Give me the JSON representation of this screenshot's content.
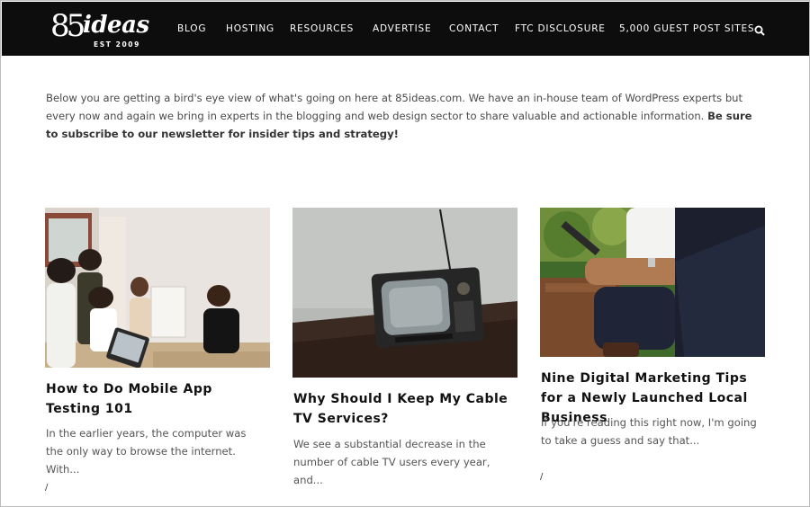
{
  "header": {
    "logo": {
      "number": "85",
      "word": "ideas",
      "tagline": "EST 2009"
    },
    "nav": [
      {
        "label": "BLOG"
      },
      {
        "label": "HOSTING"
      },
      {
        "label": "RESOURCES"
      },
      {
        "label": "ADVERTISE"
      },
      {
        "label": "CONTACT"
      },
      {
        "label": "FTC DISCLOSURE"
      },
      {
        "label": "5,000 GUEST POST SITES"
      }
    ],
    "search_icon": "search-icon"
  },
  "intro": {
    "text": "Below you are getting a bird's eye view of what's going on here at 85ideas.com. We have an in-house team of WordPress experts but every now and again we bring in experts in the blogging and web design sector to share valuable and actionable information. ",
    "bold": "Be sure to subscribe to our newsletter for insider tips and strategy!"
  },
  "posts": [
    {
      "title": "How to Do Mobile App Testing 101",
      "excerpt": "In the earlier years, the computer was the only way to browse the internet. With...",
      "separator": "/"
    },
    {
      "title": "Why Should I Keep My Cable TV Services?",
      "excerpt": "We see a substantial decrease in the number of cable TV users every year, and...",
      "separator": ""
    },
    {
      "title": "Nine Digital Marketing Tips for a Newly Launched Local Business",
      "excerpt": "If you're reading this right now, I'm going to take a guess and say that...",
      "separator": "/"
    }
  ],
  "colors": {
    "header_bg": "#0d0d0d",
    "title": "#111111",
    "body_text": "#555555"
  }
}
